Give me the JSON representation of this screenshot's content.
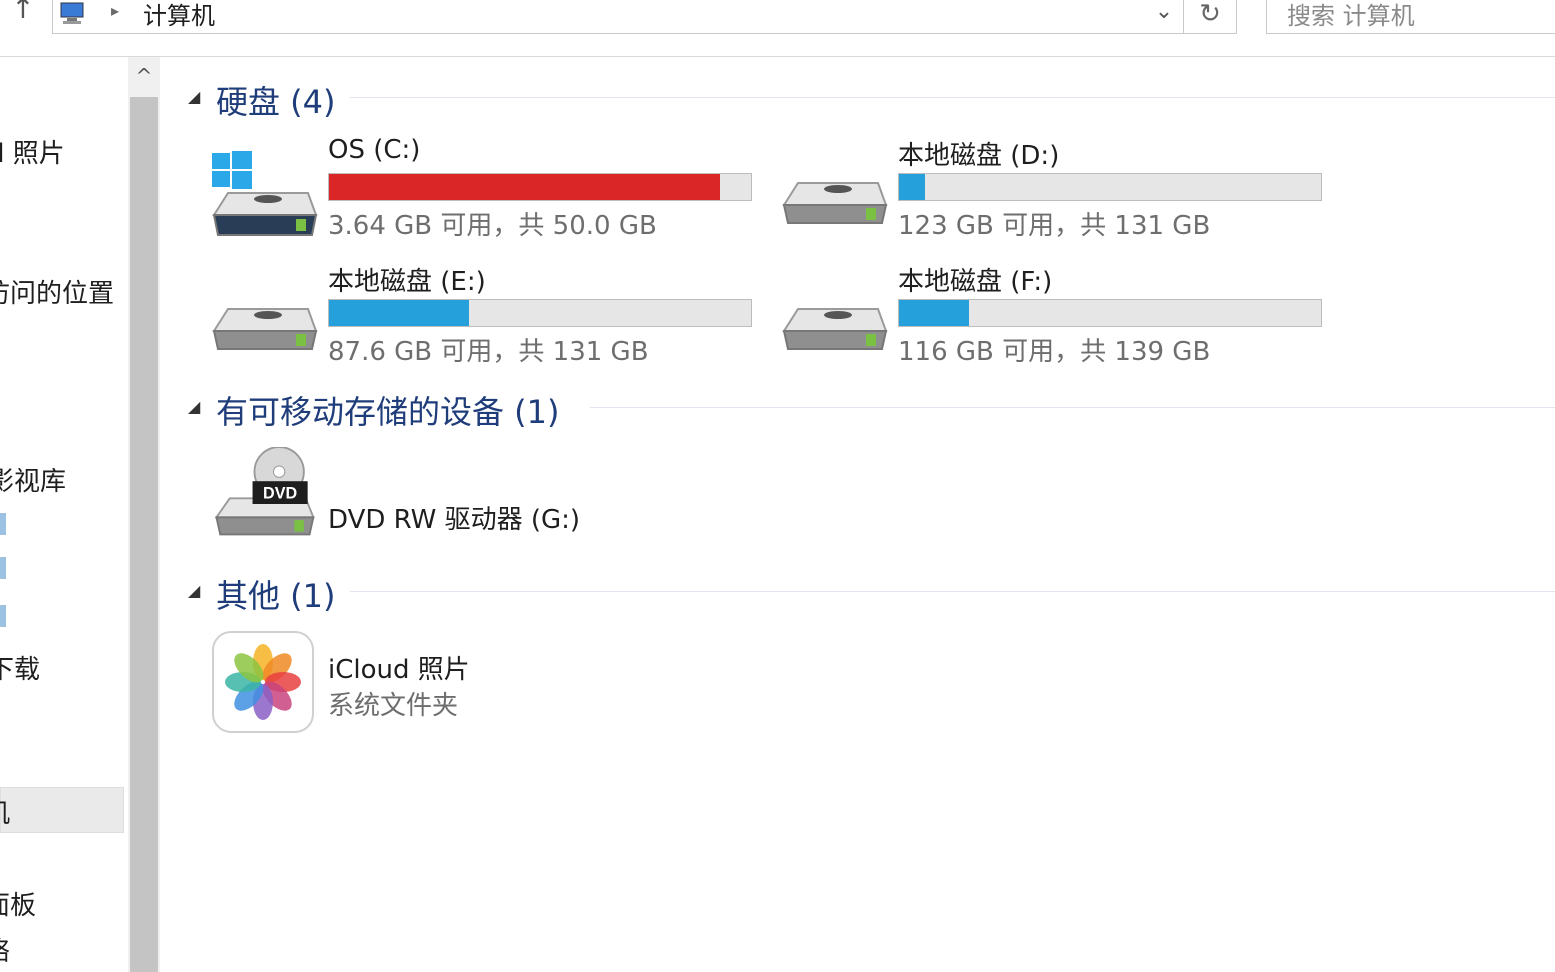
{
  "toolbar": {
    "up_glyph": "↑",
    "breadcrumb_sep": "▸",
    "breadcrumb": "计算机",
    "dropdown_glyph": "⌄",
    "refresh_glyph": "↻",
    "search_placeholder": "搜索 计算机"
  },
  "nav": {
    "items": [
      "d 照片",
      "访问的位置",
      "影视库",
      "下载",
      "机",
      "面板",
      "络"
    ],
    "scroll_up_glyph": "^"
  },
  "groups": {
    "hard_disks": {
      "title": "硬盘 (4)"
    },
    "removable": {
      "title": "有可移动存储的设备 (1)"
    },
    "other": {
      "title": "其他 (1)"
    }
  },
  "drives": [
    {
      "name": "OS (C:)",
      "info": "3.64 GB 可用，共 50.0 GB",
      "used_fraction": 0.927,
      "color": "#da2626"
    },
    {
      "name": "本地磁盘 (D:)",
      "info": "123 GB 可用，共 131 GB",
      "used_fraction": 0.061,
      "color": "#26a0da"
    },
    {
      "name": "本地磁盘 (E:)",
      "info": "87.6 GB 可用，共 131 GB",
      "used_fraction": 0.331,
      "color": "#26a0da"
    },
    {
      "name": "本地磁盘 (F:)",
      "info": "116 GB 可用，共 139 GB",
      "used_fraction": 0.165,
      "color": "#26a0da"
    }
  ],
  "dvd": {
    "name": "DVD RW 驱动器 (G:)",
    "badge": "DVD"
  },
  "icloud": {
    "name": "iCloud 照片",
    "sub": "系统文件夹"
  }
}
